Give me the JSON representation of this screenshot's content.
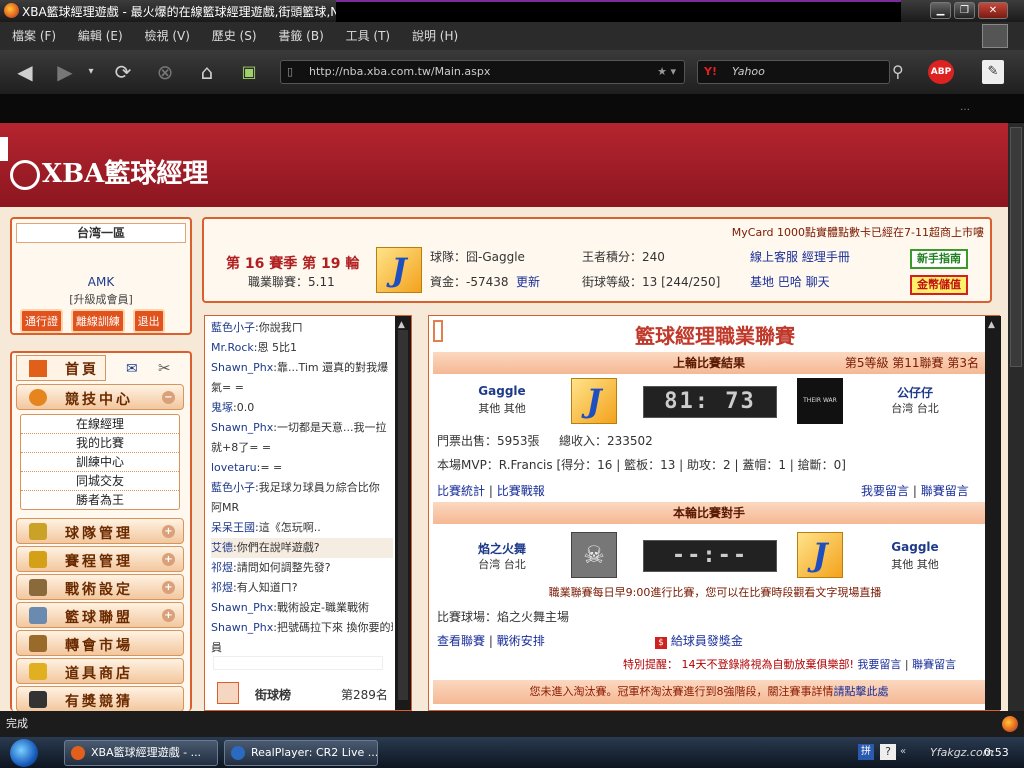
{
  "window": {
    "title": "XBA籃球經理遊戲 - 最火爆的在線籃球經理遊戲,街頭籃球,NE"
  },
  "menu": [
    "檔案 (F)",
    "編輯 (E)",
    "檢視 (V)",
    "歷史 (S)",
    "書籤 (B)",
    "工具 (T)",
    "說明 (H)"
  ],
  "nav": {
    "url": "http://nba.xba.com.tw/Main.aspx",
    "search_placeholder": "Yahoo",
    "ext_label": "ABP"
  },
  "site": {
    "logo_text": "XBA籃球經理",
    "region": "台湾一區",
    "user": "AMK",
    "member": "[升級成會員]",
    "buttons": [
      "通行證",
      "離線訓練",
      "退出"
    ]
  },
  "season": {
    "title": "第 16 賽季 第 19 輪",
    "league": "職業聯賽：5.11",
    "team": "球隊：囧-Gaggle",
    "funds": "資金：-57438",
    "update": "更新",
    "king": "王者積分：240",
    "level": "街球等級：13 [244/250]",
    "links1": "線上客服 經理手冊",
    "links2": "基地 巴哈 聊天",
    "guide": "新手指南",
    "gold": "金幣儲值",
    "marquee": "MyCard 1000點實體點數卡已經在7-11超商上市嘍"
  },
  "left_menu": {
    "home": "首頁",
    "sections": [
      {
        "label": "競技中心",
        "expanded": true,
        "subs": [
          "在線經理",
          "我的比賽",
          "訓練中心",
          "同城交友",
          "勝者為王"
        ]
      },
      {
        "label": "球隊管理"
      },
      {
        "label": "賽程管理"
      },
      {
        "label": "戰術設定"
      },
      {
        "label": "籃球聯盟"
      },
      {
        "label": "轉會市場"
      },
      {
        "label": "道具商店"
      },
      {
        "label": "有獎競猜"
      }
    ]
  },
  "chat": [
    {
      "name": "藍色小子",
      "text": ":你說我ㄇ"
    },
    {
      "name": "Mr.Rock",
      "text": ":恩 5比1"
    },
    {
      "name": "Shawn_Phx",
      "text": ":靠...Tim 還真的對我爆"
    },
    {
      "name": "",
      "text": "氣= ="
    },
    {
      "name": "鬼塚",
      "text": ":0.0"
    },
    {
      "name": "Shawn_Phx",
      "text": ":一切都是天意...我一拉"
    },
    {
      "name": "",
      "text": "就+8了= ="
    },
    {
      "name": "lovetaru",
      "text": ":= ="
    },
    {
      "name": "藍色小子",
      "text": ":我足球ㄉ球員ㄉ綜合比你"
    },
    {
      "name": "",
      "text": "阿MR"
    },
    {
      "name": "呆呆王國",
      "text": ":這《怎玩啊.."
    },
    {
      "name": "艾德",
      "text": ":你們在說咩遊戲?"
    },
    {
      "name": "祁煜",
      "text": ":請問如何調整先發?"
    },
    {
      "name": "祁煜",
      "text": ":有人知道ㄇ?"
    },
    {
      "name": "Shawn_Phx",
      "text": ":戰術設定-職業戰術"
    },
    {
      "name": "Shawn_Phx",
      "text": ":把號碼拉下來 換你要的球"
    },
    {
      "name": "",
      "text": "員"
    }
  ],
  "rank": {
    "label": "街球榜",
    "value": "第289名"
  },
  "league": {
    "title": "籃球經理職業聯賽",
    "last_title": "上輪比賽結果",
    "last_info": "第5等級 第11聯賽 第3名",
    "home_team": "Gaggle",
    "home_loc": "其他 其他",
    "score": "81: 73",
    "away_team": "公仔仔",
    "away_loc": "台湾 台北",
    "opp_badge": "THEIR WAR",
    "tickets": "門票出售：5953張",
    "income": "總收入：233502",
    "mvp": "本場MVP：R.Francis [得分：16 | 籃板：13 | 助攻：2 | 蓋帽：1 | 搶斷：0]",
    "stats_link": "比賽統計",
    "report_link": "比賽戰報",
    "msg_link": "我要留言",
    "league_msg_link": "聯賽留言",
    "next_title": "本輪比賽對手",
    "next_home": "焰之火舞",
    "next_home_loc": "台湾 台北",
    "next_score": "--:--",
    "next_away": "Gaggle",
    "next_away_loc": "其他 其他",
    "notice": "職業聯賽每日早9:00進行比賽，您可以在比賽時段觀看文字現場直播",
    "venue": "比賽球場：焰之火舞主場",
    "view_link": "查看聯賽",
    "tactic_link": "戰術安排",
    "bonus": "給球員發獎金",
    "warning": "特別提醒： 14天不登錄將視為自動放棄俱樂部!",
    "bottom": "您未進入淘汰賽。冠軍杯淘汰賽進行到8強階段，關注賽事詳情",
    "bottom_link": "請點擊此處"
  },
  "status": {
    "text": "完成"
  },
  "taskbar": {
    "tasks": [
      "XBA籃球經理遊戲 - ...",
      "RealPlayer: CR2 Live ..."
    ],
    "clock": "0:53",
    "watermark": "Yfakgz.com"
  },
  "colors": {
    "header": "#a71e2a",
    "accent": "#d9602e",
    "link": "#1a2f9a"
  }
}
